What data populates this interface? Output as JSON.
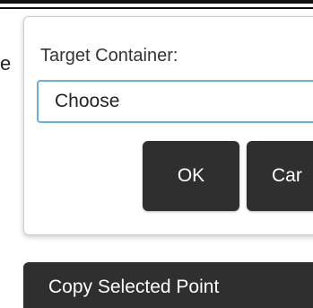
{
  "background_fragment": "e",
  "dialog": {
    "label": "Target Container:",
    "select_value": "Choose",
    "ok_label": "OK",
    "cancel_label": "Car"
  },
  "toolbar": {
    "copy_button_label": "Copy Selected Point"
  },
  "colors": {
    "button_bg": "#2f2f2f",
    "focus_border": "#66afe9"
  }
}
